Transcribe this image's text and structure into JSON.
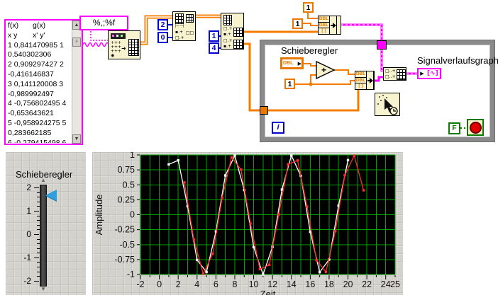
{
  "diagram": {
    "string_table": {
      "lines": [
        "f(x)\tg(x)",
        "x y\tx' y'",
        "1 0,841470985 1",
        "0,540302306",
        "2 0,909297427 2",
        "-0,416146837",
        "3 0,141120008 3",
        "-0,989992497",
        "4 -0,756802495 4",
        "-0,653643621",
        "5 -0,958924275 5",
        "0,283662185",
        "6 -0,279415498 6"
      ]
    },
    "format_string": "%,;%f",
    "constants": {
      "two": "2",
      "zero": "0",
      "one": "1",
      "four": "4",
      "one_a": "1",
      "one_b": "1",
      "loop_one": "1",
      "false_const": "F",
      "iteration": "i"
    },
    "bundle_rows": [
      "DBL",
      "DBL",
      "[ ]"
    ],
    "dbl_terminal_label": "DBL",
    "add_label": "+",
    "labels": {
      "slider": "Schieberegler",
      "graph": "Signalverlaufsgraph"
    }
  },
  "front_panel": {
    "slider": {
      "label": "Schieberegler",
      "min": -2,
      "max": 2,
      "value": 1.66,
      "tick_labels": [
        "2",
        "1",
        "0",
        "-1",
        "-2"
      ]
    }
  },
  "chart_data": {
    "type": "line",
    "title": "",
    "xlabel": "Zeit",
    "ylabel": "Amplitude",
    "xlim": [
      -2,
      25
    ],
    "ylim": [
      -1,
      1
    ],
    "x_tick_major": [
      -2,
      0,
      2,
      4,
      6,
      8,
      10,
      12,
      14,
      16,
      18,
      20,
      22,
      24,
      25
    ],
    "y_ticks": [
      1,
      0.75,
      0.5,
      0.25,
      0,
      -0.25,
      -0.5,
      -0.75,
      -1
    ],
    "grid": true,
    "bg": "#000000",
    "grid_color": "#00A400",
    "series": [
      {
        "name": "f(x)",
        "color": "#FFFFFF",
        "x_start": 1,
        "x_step": 1,
        "values": [
          0.8415,
          0.9093,
          0.1411,
          -0.7568,
          -0.9589,
          -0.2794,
          0.657,
          0.9894,
          0.4121,
          -0.544,
          -1.0,
          -0.5366,
          0.4202,
          0.9906,
          0.6503,
          -0.2879,
          -0.9614,
          -0.751,
          0.1499,
          0.9129
        ]
      },
      {
        "name": "g(x)",
        "color": "#FF2B2B",
        "x_start": 2.66,
        "x_step": 1,
        "values": [
          0.5403,
          -0.4161,
          -0.99,
          -0.6536,
          0.2837,
          0.9602,
          0.7539,
          -0.1455,
          -0.9111,
          -0.8391,
          0.0044,
          0.8439,
          0.9074,
          0.1367,
          -0.7597,
          -0.9577,
          -0.2752,
          0.6603,
          0.9887,
          0.4081
        ]
      }
    ]
  }
}
